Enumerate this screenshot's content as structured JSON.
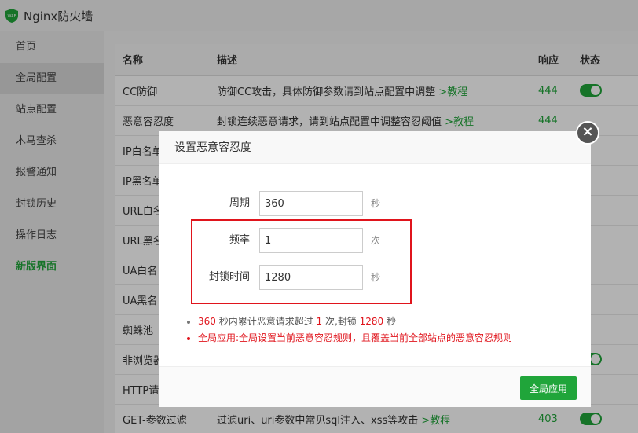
{
  "app": {
    "title": "Nginx防火墙"
  },
  "sidebar": {
    "items": [
      {
        "label": "首页"
      },
      {
        "label": "全局配置"
      },
      {
        "label": "站点配置"
      },
      {
        "label": "木马查杀"
      },
      {
        "label": "报警通知"
      },
      {
        "label": "封锁历史"
      },
      {
        "label": "操作日志"
      },
      {
        "label": "新版界面"
      }
    ]
  },
  "table": {
    "headers": {
      "name": "名称",
      "desc": "描述",
      "response": "响应",
      "status": "状态"
    },
    "rows": [
      {
        "name": "CC防御",
        "desc": "防御CC攻击，具体防御参数请到站点配置中调整 ",
        "link": ">教程",
        "code": "444",
        "toggle": true
      },
      {
        "name": "恶意容忍度",
        "desc": "封锁连续恶意请求，请到站点配置中调整容忍阈值 ",
        "link": ">教程",
        "code": "444",
        "toggle": false
      },
      {
        "name": "IP白名单",
        "desc": "",
        "link": "",
        "code": "",
        "toggle": false
      },
      {
        "name": "IP黑名单",
        "desc": "",
        "link": "",
        "code": "",
        "toggle": false
      },
      {
        "name": "URL白名单",
        "desc": "",
        "link": "",
        "code": "",
        "toggle": false
      },
      {
        "name": "URL黑名单",
        "desc": "",
        "link": "",
        "code": "",
        "toggle": false
      },
      {
        "name": "UA白名单",
        "desc": "",
        "link": "",
        "code": "",
        "toggle": false
      },
      {
        "name": "UA黑名单",
        "desc": "",
        "link": "",
        "code": "",
        "toggle": false
      },
      {
        "name": "蜘蛛池",
        "desc": "",
        "link": "",
        "code": "",
        "toggle": false
      },
      {
        "name": "非浏览器",
        "desc": "",
        "link": "",
        "code": "",
        "toggle": true
      },
      {
        "name": "HTTP请求",
        "desc": "",
        "link": "",
        "code": "",
        "toggle": false
      },
      {
        "name": "GET-参数过滤",
        "desc": "过滤uri、uri参数中常见sql注入、xss等攻击 ",
        "link": ">教程",
        "code": "403",
        "toggle": true
      }
    ]
  },
  "modal": {
    "title": "设置恶意容忍度",
    "close": "×",
    "fields": {
      "cycle": {
        "label": "周期",
        "value": "360",
        "unit": "秒"
      },
      "frequency": {
        "label": "频率",
        "value": "1",
        "unit": "次"
      },
      "block_time": {
        "label": "封锁时间",
        "value": "1280",
        "unit": "秒"
      }
    },
    "notes": {
      "line1": {
        "v1": "360",
        "t1": " 秒内累计恶意请求超过 ",
        "v2": "1",
        "t2": " 次,封锁 ",
        "v3": "1280",
        "t3": " 秒"
      },
      "line2": "全局应用:全局设置当前恶意容忍规则，且覆盖当前全部站点的恶意容忍规则"
    },
    "apply_button": "全局应用"
  },
  "colors": {
    "accent": "#20a53a",
    "danger": "#e0141c"
  }
}
